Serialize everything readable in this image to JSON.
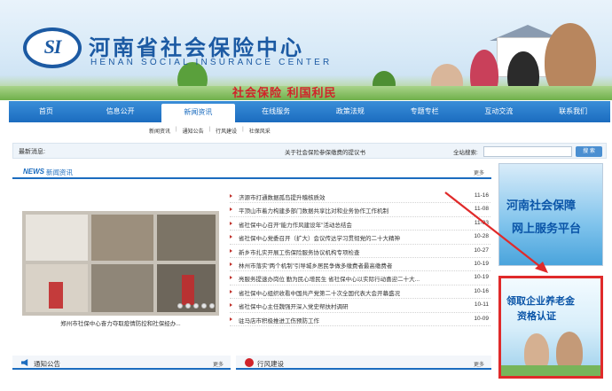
{
  "header": {
    "logo_text": "SI",
    "site_name_cn": "河南省社会保险中心",
    "site_name_en": "HENAN SOCIAL INSURANCE CENTER",
    "slogan": "社会保险 利国利民"
  },
  "nav": {
    "items": [
      {
        "label": "首页"
      },
      {
        "label": "信息公开"
      },
      {
        "label": "新闻资讯"
      },
      {
        "label": "在线服务"
      },
      {
        "label": "政策法规"
      },
      {
        "label": "专题专栏"
      },
      {
        "label": "互动交流"
      },
      {
        "label": "联系我们"
      }
    ],
    "active": "新闻资讯",
    "subnav": [
      "新闻资讯",
      "通知公告",
      "行风建设",
      "社保风采"
    ]
  },
  "notice": {
    "label": "最新消息:",
    "message": "关于社会保险参保缴费的提议书",
    "search_label": "全站搜索:",
    "search_value": "",
    "search_button": "搜 索"
  },
  "news": {
    "tag": "NEWS",
    "title": "新闻资讯",
    "more": "更多",
    "photo_caption": "郑州市社保中心奋力夺取疫情防控和社保经办...",
    "items": [
      {
        "title": "济源市打通数据孤岛提升稽核质效",
        "date": "11-16"
      },
      {
        "title": "平顶山市着力构建多部门数据共享比对和业务协作工作机制",
        "date": "11-08"
      },
      {
        "title": "省社保中心召开“能力作风建设年”活动总结会",
        "date": "11-03"
      },
      {
        "title": "省社保中心党委召开（扩大）会议传达学习贯彻党的二十大精神",
        "date": "10-28"
      },
      {
        "title": "新乡市扎实开展工伤保险服务协议机构专项检查",
        "date": "10-27"
      },
      {
        "title": "林州市落实“两个机制”引导城乡居民争做多缴费者最高缴费者",
        "date": "10-19"
      },
      {
        "title": "亮服务提速办岗位 勤为民心增民生 省社保中心以实际行动喜迎二十大...",
        "date": "10-19"
      },
      {
        "title": "省社保中心组织收看中国共产党第二十次全国代表大会开幕盛况",
        "date": "10-16"
      },
      {
        "title": "省社保中心主任魏强开深入党史帮扶村调研",
        "date": "10-11"
      },
      {
        "title": "驻马店市积极推进工伤预防工作",
        "date": "10-09"
      }
    ]
  },
  "panels": {
    "notice_title": "通知公告",
    "notice_more": "更多",
    "conduct_title": "行风建设",
    "conduct_more": "更多"
  },
  "side": {
    "banner1_line1": "河南社会保障",
    "banner1_line2": "网上服务平台",
    "banner2_line1": "领取企业养老金",
    "banner2_line2": "资格认证"
  },
  "colors": {
    "primary": "#1b6cbf",
    "accent_red": "#d0232a",
    "highlight_border": "#e02a2a"
  }
}
